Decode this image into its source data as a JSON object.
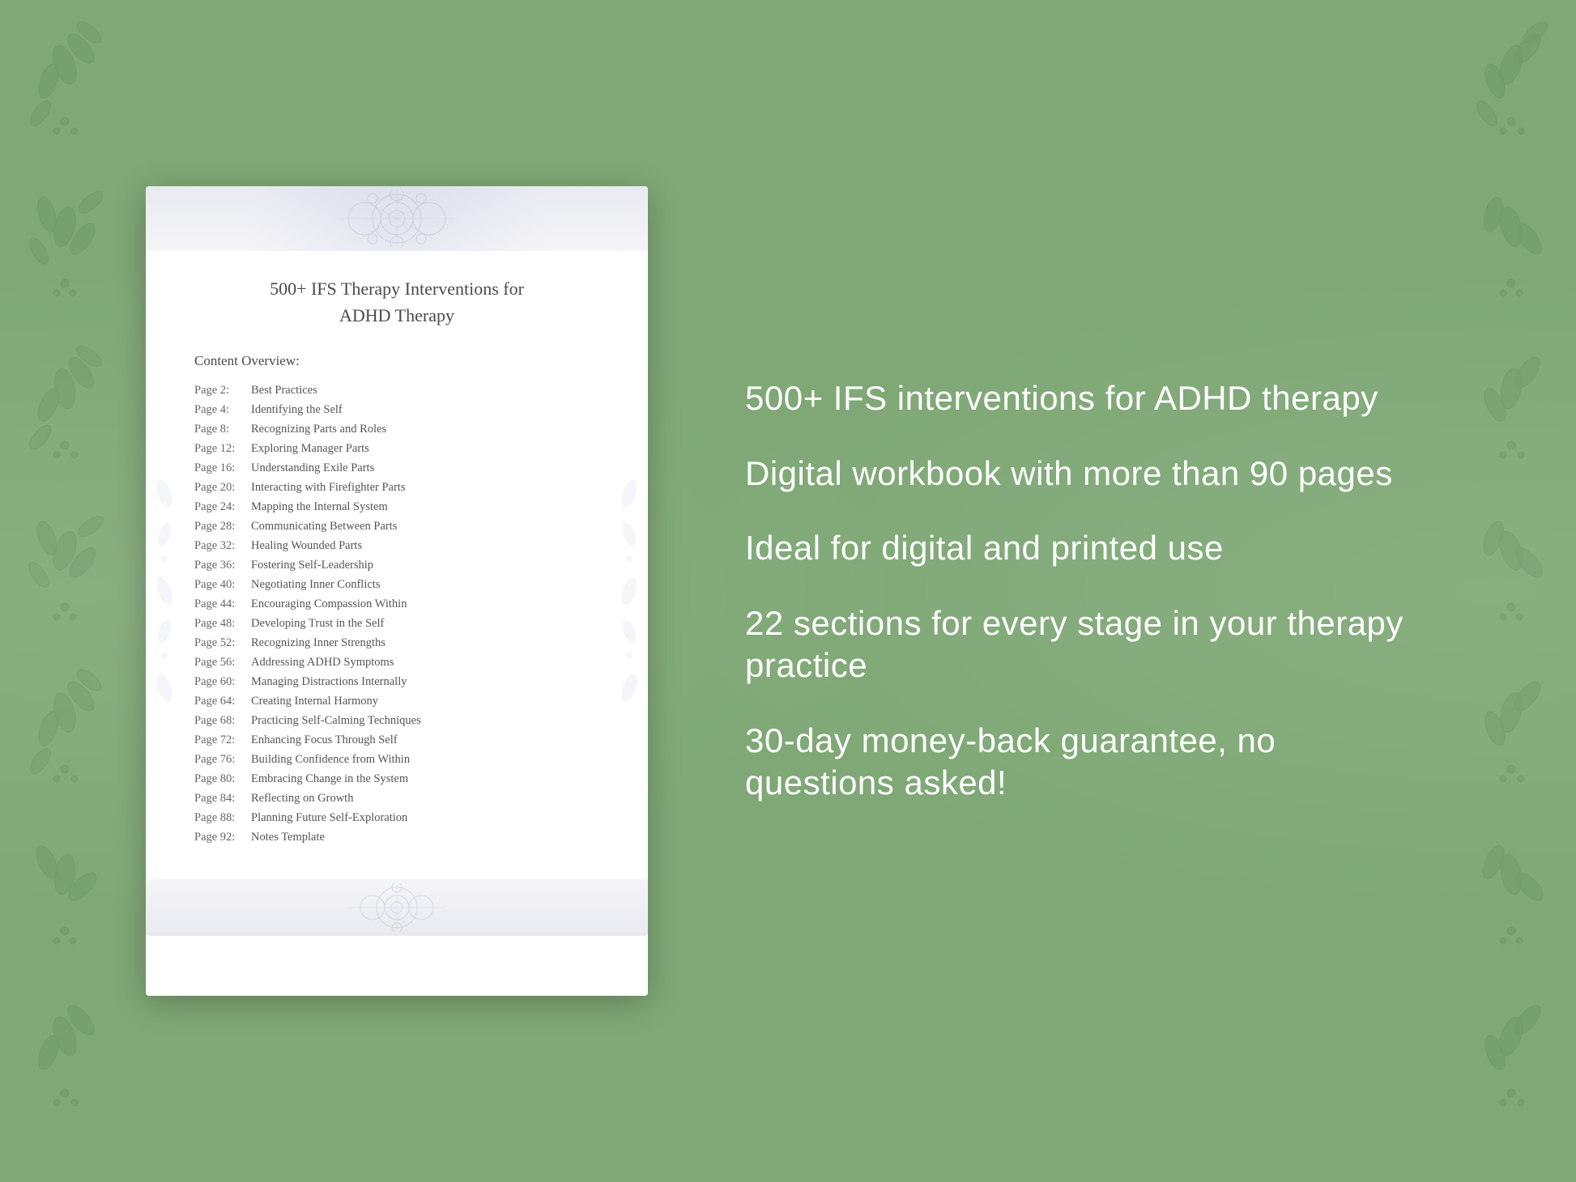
{
  "background": {
    "color": "#7fa876"
  },
  "document": {
    "title_line1": "500+ IFS Therapy Interventions for",
    "title_line2": "ADHD Therapy",
    "content_overview_label": "Content Overview:",
    "toc": [
      {
        "page": "Page  2:",
        "title": "Best Practices"
      },
      {
        "page": "Page  4:",
        "title": "Identifying the Self"
      },
      {
        "page": "Page  8:",
        "title": "Recognizing Parts and Roles"
      },
      {
        "page": "Page 12:",
        "title": "Exploring Manager Parts"
      },
      {
        "page": "Page 16:",
        "title": "Understanding Exile Parts"
      },
      {
        "page": "Page 20:",
        "title": "Interacting with Firefighter Parts"
      },
      {
        "page": "Page 24:",
        "title": "Mapping the Internal System"
      },
      {
        "page": "Page 28:",
        "title": "Communicating Between Parts"
      },
      {
        "page": "Page 32:",
        "title": "Healing Wounded Parts"
      },
      {
        "page": "Page 36:",
        "title": "Fostering Self-Leadership"
      },
      {
        "page": "Page 40:",
        "title": "Negotiating Inner Conflicts"
      },
      {
        "page": "Page 44:",
        "title": "Encouraging Compassion Within"
      },
      {
        "page": "Page 48:",
        "title": "Developing Trust in the Self"
      },
      {
        "page": "Page 52:",
        "title": "Recognizing Inner Strengths"
      },
      {
        "page": "Page 56:",
        "title": "Addressing ADHD Symptoms"
      },
      {
        "page": "Page 60:",
        "title": "Managing Distractions Internally"
      },
      {
        "page": "Page 64:",
        "title": "Creating Internal Harmony"
      },
      {
        "page": "Page 68:",
        "title": "Practicing Self-Calming Techniques"
      },
      {
        "page": "Page 72:",
        "title": "Enhancing Focus Through Self"
      },
      {
        "page": "Page 76:",
        "title": "Building Confidence from Within"
      },
      {
        "page": "Page 80:",
        "title": "Embracing Change in the System"
      },
      {
        "page": "Page 84:",
        "title": "Reflecting on Growth"
      },
      {
        "page": "Page 88:",
        "title": "Planning Future Self-Exploration"
      },
      {
        "page": "Page 92:",
        "title": "Notes Template"
      }
    ]
  },
  "features": [
    {
      "id": "feature-1",
      "text": "500+ IFS interventions for ADHD therapy"
    },
    {
      "id": "feature-2",
      "text": "Digital workbook with more than 90 pages"
    },
    {
      "id": "feature-3",
      "text": "Ideal for digital and printed use"
    },
    {
      "id": "feature-4",
      "text": "22 sections for every stage in your therapy practice"
    },
    {
      "id": "feature-5",
      "text": "30-day money-back guarantee, no questions asked!"
    }
  ]
}
